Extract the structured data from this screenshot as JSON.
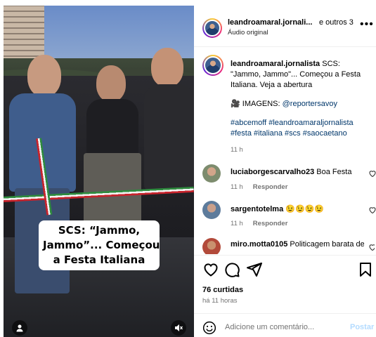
{
  "video": {
    "caption_lines": [
      "SCS: “Jammo,",
      "Jammo”... Começou",
      "a Festa Italiana"
    ]
  },
  "header": {
    "username": "leandroamaral.jornali...",
    "others": "e outros 3",
    "audio": "Áudio original"
  },
  "post": {
    "username": "leandroamaral.jornalista",
    "caption": "SCS: \"Jammo, Jammo\"... Começou a Festa Italiana. Veja a abertura",
    "credit_prefix": "IMAGENS:",
    "credit_handle": "@reportersavoy",
    "hashtags": "#abcemoff #leandroamaraljornalista #festa #italiana #scs #saocaetano",
    "time": "11 h"
  },
  "comments": [
    {
      "username": "luciaborgescarvalho23",
      "text": "Boa Festa",
      "time": "11 h",
      "reply": "Responder"
    },
    {
      "username": "sargentotelma",
      "text": "😉😉😉😉",
      "time": "11 h",
      "reply": "Responder"
    },
    {
      "username": "miro.motta0105",
      "text": "Politicagem barata de prefeito",
      "time": "",
      "reply": ""
    }
  ],
  "stats": {
    "likes": "76 curtidas",
    "posted": "há 11 horas"
  },
  "composer": {
    "placeholder": "Adicione um comentário...",
    "post_label": "Postar"
  },
  "icons": {
    "more": "more-horizontal-icon",
    "like": "heart-icon",
    "comment": "speech-bubble-icon",
    "share": "paper-plane-icon",
    "save": "bookmark-icon",
    "emoji": "emoji-icon",
    "user": "user-tag-icon",
    "mute": "muted-speaker-icon"
  },
  "colors": {
    "link": "#00376b",
    "muted_text": "#737373",
    "post_button": "#b3dbff"
  }
}
